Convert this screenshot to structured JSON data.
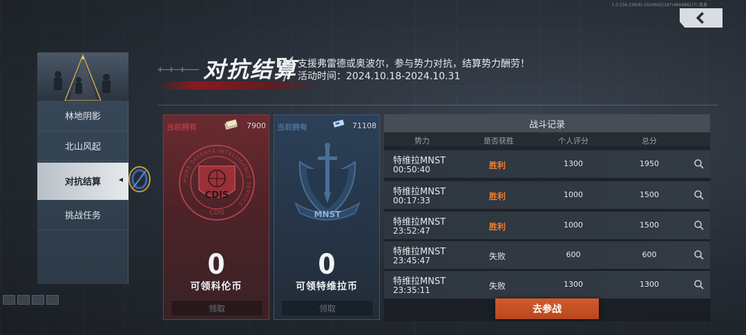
{
  "header": {
    "title": "对抗结算",
    "help_symbol": "?",
    "description": "支援弗雷德或奥波尔，参与势力对抗，结算势力酬劳！",
    "period": "活动时间：2024.10.18-2024.10.31"
  },
  "build_info": "1.0.156.156(6) 1020602(187)4664861(7) 真身",
  "sidebar": {
    "items": [
      {
        "label": "林地阴影",
        "active": false
      },
      {
        "label": "北山风起",
        "active": false
      },
      {
        "label": "对抗结算",
        "active": true
      },
      {
        "label": "挑战任务",
        "active": false
      }
    ]
  },
  "cards": {
    "kc": {
      "own_label": "当前拥有",
      "count": "7900",
      "amount": "0",
      "label": "可领科伦币",
      "claim": "领取",
      "emblem_text": "CDIS",
      "emblem_ring": "HOME DEFENSE INTELLIGENCE SERVICE",
      "color": "#c8484e"
    },
    "mn": {
      "own_label": "当前拥有",
      "count": "71108",
      "amount": "0",
      "label": "可领特维拉币",
      "claim": "领取",
      "emblem_text": "MNST",
      "color": "#5a8ac0"
    }
  },
  "records": {
    "title": "战斗记录",
    "columns": [
      "势力",
      "是否获胜",
      "个人评分",
      "总分"
    ],
    "rows": [
      {
        "faction": "特维拉MNST",
        "time": "00:50:40",
        "result": "胜利",
        "win": true,
        "personal": "1300",
        "total": "1950"
      },
      {
        "faction": "特维拉MNST",
        "time": "00:17:33",
        "result": "胜利",
        "win": true,
        "personal": "1000",
        "total": "1500"
      },
      {
        "faction": "特维拉MNST",
        "time": "23:52:47",
        "result": "胜利",
        "win": true,
        "personal": "1000",
        "total": "1500"
      },
      {
        "faction": "特维拉MNST",
        "time": "23:45:47",
        "result": "失败",
        "win": false,
        "personal": "600",
        "total": "600"
      },
      {
        "faction": "特维拉MNST",
        "time": "23:35:11",
        "result": "失败",
        "win": false,
        "personal": "1300",
        "total": "1300"
      }
    ],
    "win_color": "#f07e2e"
  },
  "join_button": "去参战",
  "accent_color": "#c9552a"
}
